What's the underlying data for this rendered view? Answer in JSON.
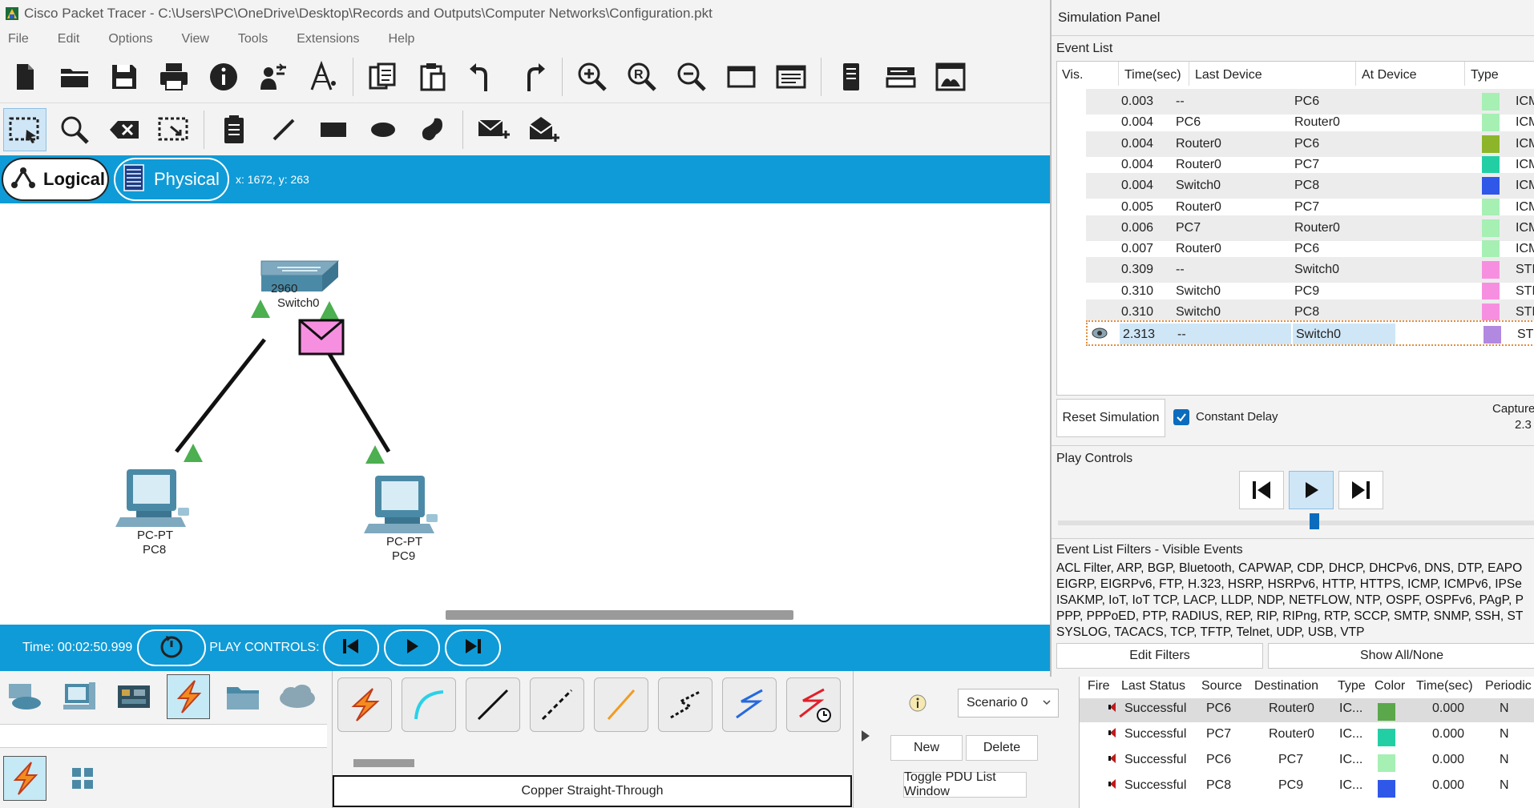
{
  "window": {
    "title": "Cisco Packet Tracer - C:\\Users\\PC\\OneDrive\\Desktop\\Records and Outputs\\Computer Networks\\Configuration.pkt"
  },
  "menu": [
    "File",
    "Edit",
    "Options",
    "View",
    "Tools",
    "Extensions",
    "Help"
  ],
  "toolbar_main": [
    "new-file-icon",
    "open-folder-icon",
    "save-icon",
    "print-icon",
    "info-icon",
    "activity-wizard-icon",
    "custom-device-icon",
    "copy-icon",
    "paste-icon",
    "undo-icon",
    "redo-icon",
    "zoom-in-icon",
    "zoom-reset-icon",
    "zoom-out-icon",
    "palette-window-icon",
    "viewport-icon",
    "notes-icon",
    "device-template-icon",
    "web-view-icon"
  ],
  "toolbar_edit": [
    "select-icon",
    "inspect-icon",
    "delete-icon",
    "resize-icon",
    "note-icon",
    "draw-line-icon",
    "rectangle-icon",
    "ellipse-icon",
    "freeform-icon",
    "add-simple-pdu-icon",
    "add-complex-pdu-icon"
  ],
  "mode": {
    "logical": "Logical",
    "physical": "Physical",
    "coords": "x: 1672, y: 263"
  },
  "topology": {
    "switch": {
      "model": "2960",
      "name": "Switch0"
    },
    "pcs": [
      {
        "type": "PC-PT",
        "name": "PC8"
      },
      {
        "type": "PC-PT",
        "name": "PC9"
      }
    ],
    "pdu_color": "#f78fe0",
    "link_up_color": "#4caf50"
  },
  "sim_bar": {
    "time": "Time: 00:02:50.999",
    "play_controls_label": "PLAY CONTROLS:"
  },
  "palette": {
    "categories": [
      "network-devices-icon",
      "end-devices-icon",
      "components-icon",
      "connections-icon",
      "miscellaneous-icon",
      "multiuser-icon"
    ],
    "selected_category": "connections-icon",
    "subcategories": [
      "connections-icon",
      "grid-icon"
    ],
    "cables": [
      "automatic-connection-icon",
      "console-cable-icon",
      "copper-straight-through-icon",
      "copper-cross-over-icon",
      "fiber-icon",
      "phone-cable-icon",
      "coaxial-cable-icon",
      "serial-dce-icon"
    ],
    "selected_cable_label": "Copper Straight-Through"
  },
  "scenario": {
    "selected": "Scenario 0",
    "new_label": "New",
    "delete_label": "Delete",
    "toggle_label": "Toggle PDU List Window"
  },
  "pdu_list": {
    "headers": [
      "Fire",
      "Last Status",
      "Source",
      "Destination",
      "Type",
      "Color",
      "Time(sec)",
      "Periodic"
    ],
    "rows": [
      {
        "status": "Successful",
        "source": "PC6",
        "destination": "Router0",
        "type": "IC...",
        "color": "#5aa84a",
        "time": "0.000",
        "periodic": "N"
      },
      {
        "status": "Successful",
        "source": "PC7",
        "destination": "Router0",
        "type": "IC...",
        "color": "#22cfa5",
        "time": "0.000",
        "periodic": "N"
      },
      {
        "status": "Successful",
        "source": "PC6",
        "destination": "PC7",
        "type": "IC...",
        "color": "#a6f0b4",
        "time": "0.000",
        "periodic": "N"
      },
      {
        "status": "Successful",
        "source": "PC8",
        "destination": "PC9",
        "type": "IC...",
        "color": "#2f57e8",
        "time": "0.000",
        "periodic": "N"
      }
    ]
  },
  "sim_panel": {
    "title": "Simulation Panel",
    "event_list_label": "Event List",
    "headers": [
      "Vis.",
      "Time(sec)",
      "Last Device",
      "At Device",
      "Type"
    ],
    "events": [
      {
        "time": "0.003",
        "last": "--",
        "at": "PC6",
        "color": "#a6f0b4",
        "type": "ICMP"
      },
      {
        "time": "0.004",
        "last": "PC6",
        "at": "Router0",
        "color": "#a6f0b4",
        "type": "ICMP"
      },
      {
        "time": "0.004",
        "last": "Router0",
        "at": "PC6",
        "color": "#8db52a",
        "type": "ICMP"
      },
      {
        "time": "0.004",
        "last": "Router0",
        "at": "PC7",
        "color": "#22cfa5",
        "type": "ICMP"
      },
      {
        "time": "0.004",
        "last": "Switch0",
        "at": "PC8",
        "color": "#2f57e8",
        "type": "ICMP"
      },
      {
        "time": "0.005",
        "last": "Router0",
        "at": "PC7",
        "color": "#a6f0b4",
        "type": "ICMP"
      },
      {
        "time": "0.006",
        "last": "PC7",
        "at": "Router0",
        "color": "#a6f0b4",
        "type": "ICMP"
      },
      {
        "time": "0.007",
        "last": "Router0",
        "at": "PC6",
        "color": "#a6f0b4",
        "type": "ICMP"
      },
      {
        "time": "0.309",
        "last": "--",
        "at": "Switch0",
        "color": "#f78fe0",
        "type": "STP"
      },
      {
        "time": "0.310",
        "last": "Switch0",
        "at": "PC9",
        "color": "#f78fe0",
        "type": "STP"
      },
      {
        "time": "0.310",
        "last": "Switch0",
        "at": "PC8",
        "color": "#f78fe0",
        "type": "STP"
      },
      {
        "time": "2.313",
        "last": "--",
        "at": "Switch0",
        "color": "#b189e0",
        "type": "STP"
      }
    ],
    "reset_label": "Reset Simulation",
    "constant_delay_label": "Constant Delay",
    "captured_label": "Capture",
    "captured_value": "2.3",
    "play_controls_label": "Play Controls",
    "filters_label": "Event List Filters - Visible Events",
    "filters_lines": [
      "ACL Filter, ARP, BGP, Bluetooth, CAPWAP, CDP, DHCP, DHCPv6, DNS, DTP, EAPO",
      "EIGRP, EIGRPv6, FTP, H.323, HSRP, HSRPv6, HTTP, HTTPS, ICMP, ICMPv6, IPSe",
      "ISAKMP, IoT, IoT TCP, LACP, LLDP, NDP, NETFLOW, NTP, OSPF, OSPFv6, PAgP, P",
      "PPP, PPPoED, PTP, RADIUS, REP, RIP, RIPng, RTP, SCCP, SMTP, SNMP, SSH, ST",
      "SYSLOG, TACACS, TCP, TFTP, Telnet, UDP, USB, VTP"
    ],
    "edit_filters_label": "Edit Filters",
    "show_all_label": "Show All/None"
  }
}
